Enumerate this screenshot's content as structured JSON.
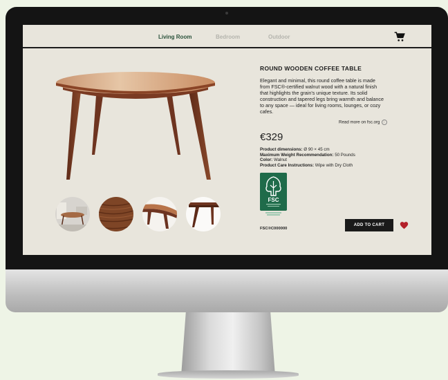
{
  "nav": {
    "tabs": [
      {
        "label": "Living Room",
        "active": true
      },
      {
        "label": "Bedroom",
        "active": false
      },
      {
        "label": "Outdoor",
        "active": false
      }
    ],
    "cart_icon": "cart-icon"
  },
  "product": {
    "title": "ROUND WOODEN COFFEE TABLE",
    "description": "Elegant and minimal, this round coffee table is made from FSC®-certified walnut wood with a natural finish that highlights the grain's unique texture. Its solid construction and tapered legs bring warmth and balance to any space — ideal for living rooms, lounges, or cozy cafes.",
    "read_more": "Read more on fsc.org",
    "price": "€329",
    "specs": [
      {
        "label": "Product dimensions:",
        "value": "Ø 90 × 45 cm"
      },
      {
        "label": "Maximum Weight Recommendation:",
        "value": "50 Pounds"
      },
      {
        "label": "Color:",
        "value": "Walnut"
      },
      {
        "label": "Product Care Instructions:",
        "value": "Wipe with Dry Cloth"
      }
    ],
    "fsc_mark": "FSC",
    "fsc_code": "FSC®C000000",
    "add_to_cart": "ADD TO CART"
  },
  "colors": {
    "accent_green": "#29513a",
    "fsc_green": "#1f6b4a",
    "heart_red": "#b3202a",
    "screen_bg": "#e8e5dc",
    "page_bg": "#eef4e6"
  }
}
